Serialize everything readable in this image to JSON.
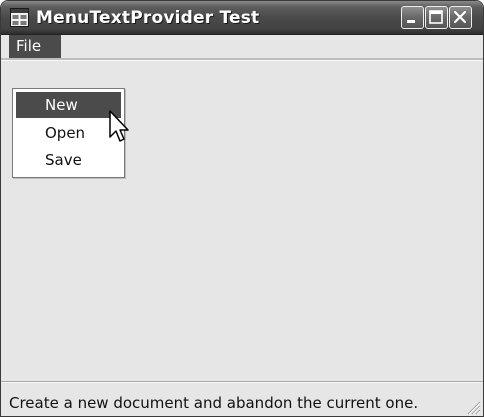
{
  "window": {
    "title": "MenuTextProvider Test"
  },
  "menubar": {
    "items": [
      {
        "label": "File"
      }
    ]
  },
  "dropdown": {
    "items": [
      {
        "label": "New",
        "selected": true
      },
      {
        "label": "Open"
      },
      {
        "label": "Save"
      }
    ]
  },
  "statusbar": {
    "text": "Create a new document and abandon the current one."
  },
  "icons": {
    "app": "window-app-icon",
    "minimize": "minimize-icon",
    "maximize": "maximize-icon",
    "close": "close-icon",
    "cursor": "mouse-pointer-icon",
    "grip": "size-grip-icon"
  },
  "colors": {
    "titlebar": "#4a4a4a",
    "menu_highlight": "#4b4b4b",
    "window_bg": "#e6e6e6"
  }
}
